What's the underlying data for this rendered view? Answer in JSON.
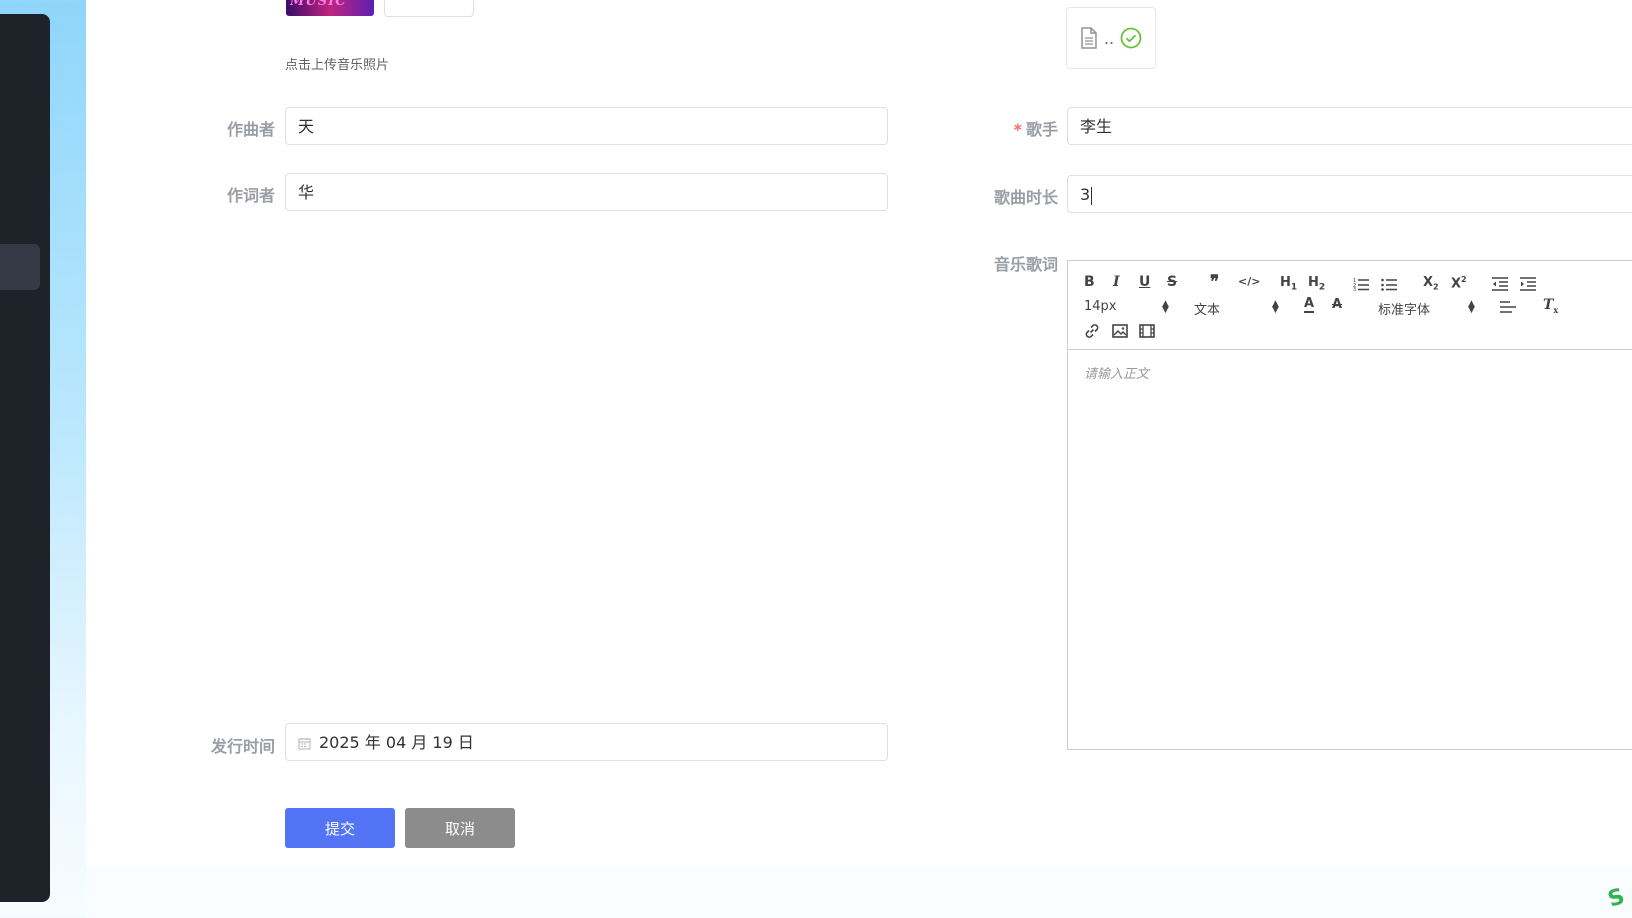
{
  "upload": {
    "thumbnail_text": "MUSIC",
    "hint": "点击上传音乐照片",
    "file_card_name": ".."
  },
  "form": {
    "composer": {
      "label": "作曲者",
      "value": "天"
    },
    "lyricist": {
      "label": "作词者",
      "value": "华"
    },
    "singer": {
      "label": "歌手",
      "required_mark": "*",
      "value": "李生"
    },
    "duration": {
      "label": "歌曲时长",
      "value": "3"
    },
    "lyrics": {
      "label": "音乐歌词"
    },
    "release_date": {
      "label": "发行时间",
      "value": "2025 年 04 月 19 日"
    }
  },
  "editor": {
    "font_size": "14px",
    "block_format": "文本",
    "font_family": "标准字体",
    "placeholder": "请输入正文",
    "toolbar_icons": [
      "bold-icon",
      "italic-icon",
      "underline-icon",
      "strikethrough-icon",
      "blockquote-icon",
      "code-icon",
      "h1-icon",
      "h2-icon",
      "ordered-list-icon",
      "unordered-list-icon",
      "subscript-icon",
      "superscript-icon",
      "outdent-icon",
      "indent-icon",
      "font-color-icon",
      "background-color-icon",
      "align-icon",
      "clear-format-icon",
      "link-icon",
      "image-icon",
      "video-icon"
    ]
  },
  "buttons": {
    "submit": "提交",
    "cancel": "取消"
  },
  "colors": {
    "primary": "#5375f5",
    "cancel": "#8c8c8c",
    "sidebar": "#1e2229",
    "success": "#67c23a",
    "required": "#f56c6c"
  }
}
